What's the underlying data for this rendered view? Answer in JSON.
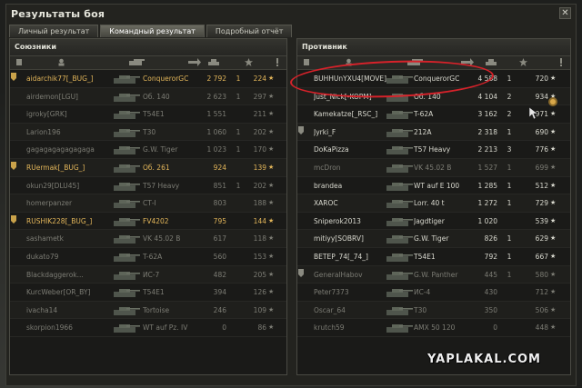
{
  "window": {
    "title": "Результаты боя",
    "close": "✕"
  },
  "tabs": [
    "Личный результат",
    "Командный результат",
    "Подробный отчёт"
  ],
  "active_tab": 1,
  "left": {
    "title": "Союзники",
    "rows": [
      {
        "name": "aidarchik77[_BUG_]",
        "vehicle": "ConquerorGC",
        "dmg": "2 792",
        "frags": "1",
        "xp": "224",
        "state": "mine",
        "platoon": true
      },
      {
        "name": "airdemon[LGU]",
        "vehicle": "Об. 140",
        "dmg": "2 623",
        "frags": "1",
        "xp": "297",
        "state": "dead"
      },
      {
        "name": "igroky[GRK]",
        "vehicle": "T54E1",
        "dmg": "1 551",
        "frags": "",
        "xp": "211",
        "state": "dead"
      },
      {
        "name": "Larion196",
        "vehicle": "T30",
        "dmg": "1 060",
        "frags": "1",
        "xp": "202",
        "state": "dead"
      },
      {
        "name": "gagagagagagagaga",
        "vehicle": "G.W. Tiger",
        "dmg": "1 023",
        "frags": "1",
        "xp": "170",
        "state": "dead"
      },
      {
        "name": "RUermak[_BUG_]",
        "vehicle": "Об. 261",
        "dmg": "924",
        "frags": "",
        "xp": "139",
        "state": "mine",
        "platoon": true
      },
      {
        "name": "okun29[DLU45]",
        "vehicle": "T57 Heavy",
        "dmg": "851",
        "frags": "1",
        "xp": "202",
        "state": "dead"
      },
      {
        "name": "homerpanzer",
        "vehicle": "СТ-I",
        "dmg": "803",
        "frags": "",
        "xp": "188",
        "state": "dead"
      },
      {
        "name": "RUSHIK228[_BUG_]",
        "vehicle": "FV4202",
        "dmg": "795",
        "frags": "",
        "xp": "144",
        "state": "mine",
        "platoon": true
      },
      {
        "name": "sashametk",
        "vehicle": "VK 45.02 B",
        "dmg": "617",
        "frags": "",
        "xp": "118",
        "state": "dead"
      },
      {
        "name": "dukato79",
        "vehicle": "T-62A",
        "dmg": "560",
        "frags": "",
        "xp": "153",
        "state": "dead"
      },
      {
        "name": "Blackdaggerok...",
        "vehicle": "ИС-7",
        "dmg": "482",
        "frags": "",
        "xp": "205",
        "state": "dead"
      },
      {
        "name": "KurcWeber[OR_BY]",
        "vehicle": "T54E1",
        "dmg": "394",
        "frags": "",
        "xp": "126",
        "state": "dead"
      },
      {
        "name": "ivacha14",
        "vehicle": "Tortoise",
        "dmg": "246",
        "frags": "",
        "xp": "109",
        "state": "dead"
      },
      {
        "name": "skorpion1966",
        "vehicle": "WT auf Pz. IV",
        "dmg": "0",
        "frags": "",
        "xp": "86",
        "state": "dead"
      }
    ]
  },
  "right": {
    "title": "Противник",
    "rows": [
      {
        "name": "BUHHUnYXU4[MOVE]",
        "vehicle": "ConquerorGC",
        "dmg": "4 588",
        "frags": "1",
        "xp": "720",
        "state": "alive"
      },
      {
        "name": "Just_Nick[-KOPM]",
        "vehicle": "Об. 140",
        "dmg": "4 104",
        "frags": "2",
        "xp": "934",
        "state": "alive"
      },
      {
        "name": "Kamekatze[_RSC_]",
        "vehicle": "T-62A",
        "dmg": "3 162",
        "frags": "2",
        "xp": "971",
        "state": "alive"
      },
      {
        "name": "Jyrki_F",
        "vehicle": "212A",
        "dmg": "2 318",
        "frags": "1",
        "xp": "690",
        "state": "alive",
        "platoon": true
      },
      {
        "name": "DoKaPizza",
        "vehicle": "T57 Heavy",
        "dmg": "2 213",
        "frags": "3",
        "xp": "776",
        "state": "alive"
      },
      {
        "name": "mcDron",
        "vehicle": "VK 45.02 B",
        "dmg": "1 527",
        "frags": "1",
        "xp": "699",
        "state": "dead"
      },
      {
        "name": "brandea",
        "vehicle": "WT auf E 100",
        "dmg": "1 285",
        "frags": "1",
        "xp": "512",
        "state": "alive"
      },
      {
        "name": "XAROC",
        "vehicle": "Lorr. 40 t",
        "dmg": "1 272",
        "frags": "1",
        "xp": "729",
        "state": "alive"
      },
      {
        "name": "Sniperok2013",
        "vehicle": "Jagdtiger",
        "dmg": "1 020",
        "frags": "",
        "xp": "539",
        "state": "alive"
      },
      {
        "name": "mitiyy[SOBRV]",
        "vehicle": "G.W. Tiger",
        "dmg": "826",
        "frags": "1",
        "xp": "629",
        "state": "alive"
      },
      {
        "name": "BETEP_74[_74_]",
        "vehicle": "T54E1",
        "dmg": "792",
        "frags": "1",
        "xp": "667",
        "state": "alive"
      },
      {
        "name": "GeneralHabov",
        "vehicle": "G.W. Panther",
        "dmg": "445",
        "frags": "1",
        "xp": "580",
        "state": "dead",
        "platoon": true
      },
      {
        "name": "Peter7373",
        "vehicle": "ИС-4",
        "dmg": "430",
        "frags": "",
        "xp": "712",
        "state": "dead"
      },
      {
        "name": "Oscar_64",
        "vehicle": "T30",
        "dmg": "350",
        "frags": "",
        "xp": "506",
        "state": "dead"
      },
      {
        "name": "krutch59",
        "vehicle": "AMX 50 120",
        "dmg": "0",
        "frags": "",
        "xp": "448",
        "state": "dead"
      }
    ]
  },
  "star": "★",
  "watermark": "YAPLAKAL.COM",
  "colors": {
    "mine": "#e3b65a",
    "alive": "#d9d9cf",
    "dead": "#7c7c74",
    "highlight": "#d6222a"
  }
}
